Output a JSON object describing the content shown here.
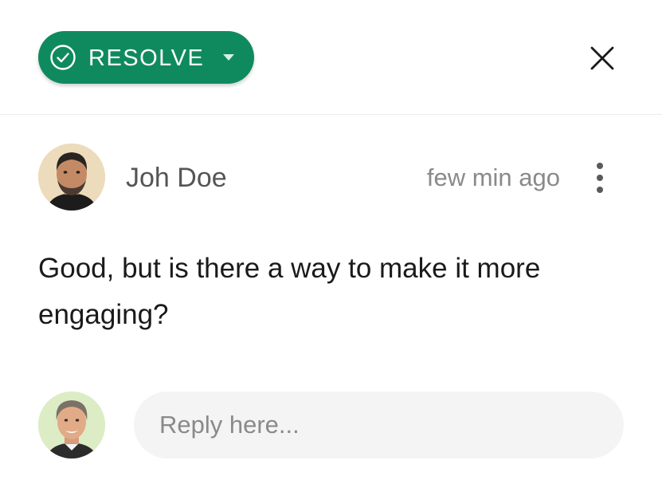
{
  "header": {
    "resolve_label": "RESOLVE",
    "resolve_color": "#0f8a5f",
    "check_icon": "circle-check-icon",
    "caret_icon": "caret-down-icon",
    "close_icon": "close-icon"
  },
  "comment": {
    "author": "Joh Doe",
    "timestamp": "few min ago",
    "text": "Good, but is there a way to make it more engaging?",
    "more_icon": "more-vertical-icon"
  },
  "reply": {
    "placeholder": "Reply here..."
  }
}
